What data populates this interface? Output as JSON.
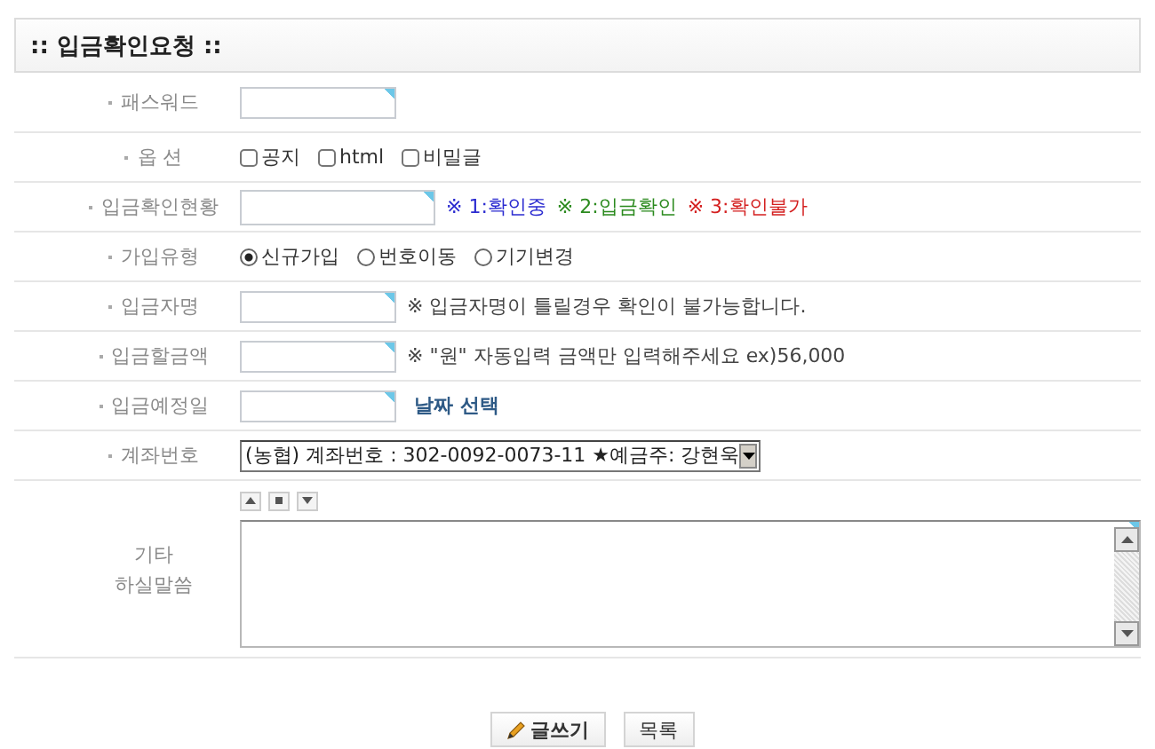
{
  "title": ":: 입금확인요청 ::",
  "fields": [
    {
      "kind": "password",
      "label": "패스워드"
    },
    {
      "kind": "checkboxes",
      "label": "옵 션",
      "options": [
        {
          "label": "공지",
          "checked": false
        },
        {
          "label": "html",
          "checked": false
        },
        {
          "label": "비밀글",
          "checked": false
        }
      ]
    },
    {
      "kind": "status",
      "label": "입금확인현황",
      "legend": [
        {
          "text": "※ 1:확인중",
          "color": "#2a2ad0"
        },
        {
          "text": "※ 2:입금확인",
          "color": "#2b8a1e"
        },
        {
          "text": "※ 3:확인불가",
          "color": "#d42020"
        }
      ]
    },
    {
      "kind": "radios",
      "label": "가입유형",
      "options": [
        {
          "label": "신규가입",
          "selected": true
        },
        {
          "label": "번호이동",
          "selected": false
        },
        {
          "label": "기기변경",
          "selected": false
        }
      ]
    },
    {
      "kind": "text",
      "label": "입금자명",
      "note": "※ 입금자명이 틀릴경우 확인이 불가능합니다."
    },
    {
      "kind": "text",
      "label": "입금할금액",
      "note": "※ \"원\" 자동입력 금액만 입력해주세요 ex)56,000"
    },
    {
      "kind": "date",
      "label": "입금예정일",
      "link": "날짜 선택"
    },
    {
      "kind": "select",
      "label": "계좌번호",
      "value": "(농협) 계좌번호 : 302-0092-0073-11 ★예금주: 강현욱"
    },
    {
      "kind": "textarea",
      "label_lines": [
        "기타",
        "하실말씀"
      ]
    }
  ],
  "buttons": [
    {
      "label": "글쓰기",
      "kind": "write"
    },
    {
      "label": "목록",
      "kind": "list"
    }
  ]
}
